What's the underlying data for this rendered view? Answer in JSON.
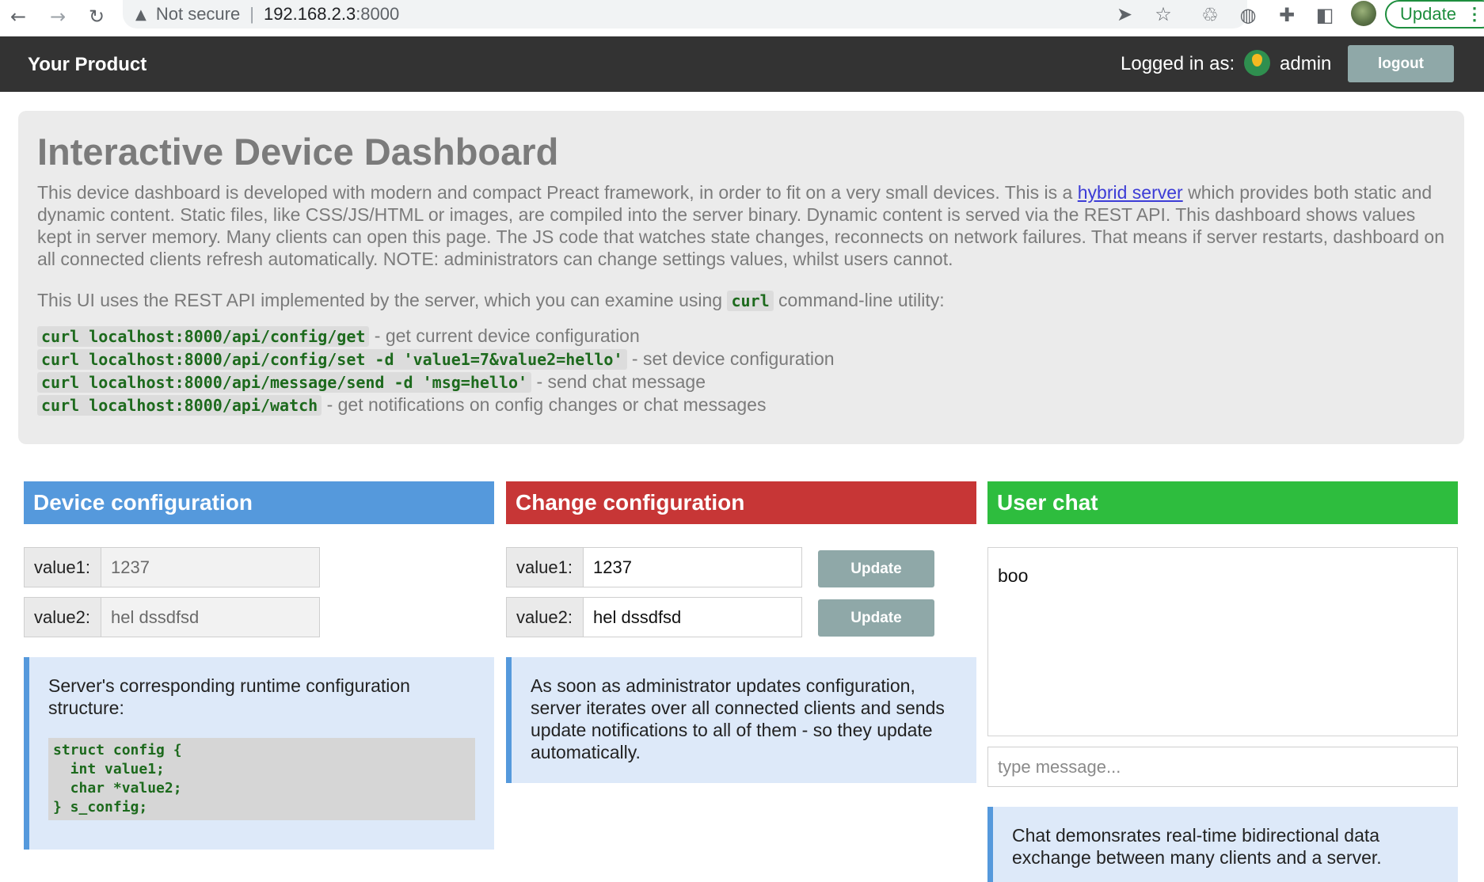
{
  "browser": {
    "security_label": "Not secure",
    "url_host": "192.168.2.3",
    "url_port": ":8000",
    "update_label": "Update"
  },
  "header": {
    "brand": "Your Product",
    "logged_in_label": "Logged in as:",
    "username": "admin",
    "logout_label": "logout"
  },
  "intro": {
    "title": "Interactive Device Dashboard",
    "para1_before_link": "This device dashboard is developed with modern and compact Preact framework, in order to fit on a very small devices. This is a ",
    "link_text": "hybrid server",
    "para1_after_link": " which provides both static and dynamic content. Static files, like CSS/JS/HTML or images, are compiled into the server binary. Dynamic content is served via the REST API. This dashboard shows values kept in server memory. Many clients can open this page. The JS code that watches state changes, reconnects on network failures. That means if server restarts, dashboard on all connected clients refresh automatically. NOTE: administrators can change settings values, whilst users cannot.",
    "para2_before": "This UI uses the REST API implemented by the server, which you can examine using ",
    "para2_code": "curl",
    "para2_after": " command-line utility:",
    "commands": [
      {
        "cmd": "curl localhost:8000/api/config/get",
        "desc": " - get current device configuration"
      },
      {
        "cmd": "curl localhost:8000/api/config/set -d 'value1=7&value2=hello'",
        "desc": " - set device configuration"
      },
      {
        "cmd": "curl localhost:8000/api/message/send -d 'msg=hello'",
        "desc": " - send chat message"
      },
      {
        "cmd": "curl localhost:8000/api/watch",
        "desc": " - get notifications on config changes or chat messages"
      }
    ]
  },
  "device_config": {
    "title": "Device configuration",
    "value1_label": "value1:",
    "value1": "1237",
    "value2_label": "value2:",
    "value2": "hel dssdfsd",
    "note": "Server's corresponding runtime configuration structure:",
    "code": "struct config {\n  int value1;\n  char *value2;\n} s_config;"
  },
  "change_config": {
    "title": "Change configuration",
    "value1_label": "value1:",
    "value1": "1237",
    "value2_label": "value2:",
    "value2": "hel dssdfsd",
    "update_label": "Update",
    "note": "As soon as administrator updates configuration, server iterates over all connected clients and sends update notifications to all of them - so they update automatically."
  },
  "chat": {
    "title": "User chat",
    "messages": [
      "boo"
    ],
    "input_placeholder": "type message...",
    "note": "Chat demonsrates real-time bidirectional data exchange between many clients and a server."
  },
  "colors": {
    "device_header": "#5599dc",
    "change_header": "#c73636",
    "chat_header": "#2ebd3e",
    "topnav": "#333333",
    "button": "#8fa8a8"
  }
}
